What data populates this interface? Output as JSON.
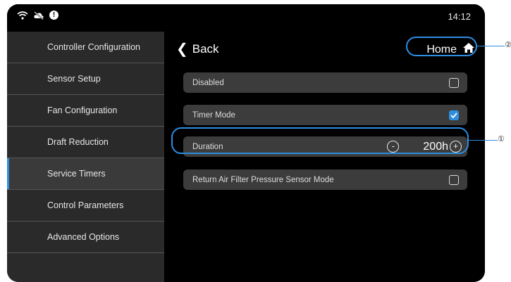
{
  "status_bar": {
    "icons": [
      "wifi-icon",
      "cloud-off-icon",
      "alert-badge-icon"
    ],
    "badge_text": "!",
    "time": "14:12"
  },
  "sidebar": {
    "items": [
      {
        "label": "Controller Configuration",
        "active": false
      },
      {
        "label": "Sensor Setup",
        "active": false
      },
      {
        "label": "Fan Configuration",
        "active": false
      },
      {
        "label": "Draft Reduction",
        "active": false
      },
      {
        "label": "Service Timers",
        "active": true
      },
      {
        "label": "Control Parameters",
        "active": false
      },
      {
        "label": "Advanced Options",
        "active": false
      }
    ]
  },
  "header": {
    "back_label": "Back",
    "home_label": "Home"
  },
  "options": {
    "disabled": {
      "label": "Disabled",
      "checked": false
    },
    "timer_mode": {
      "label": "Timer Mode",
      "checked": true
    },
    "duration": {
      "label": "Duration",
      "value": "200h",
      "minus": "-",
      "plus": "+"
    },
    "return_air": {
      "label": "Return Air Filter Pressure Sensor Mode",
      "checked": false
    }
  },
  "callouts": {
    "duration_marker": "①",
    "home_marker": "②"
  },
  "colors": {
    "accent": "#2e8ee0",
    "screen_bg": "#000000",
    "sidebar_bg": "#2a2a2a",
    "row_bg": "#3c3c3c"
  }
}
